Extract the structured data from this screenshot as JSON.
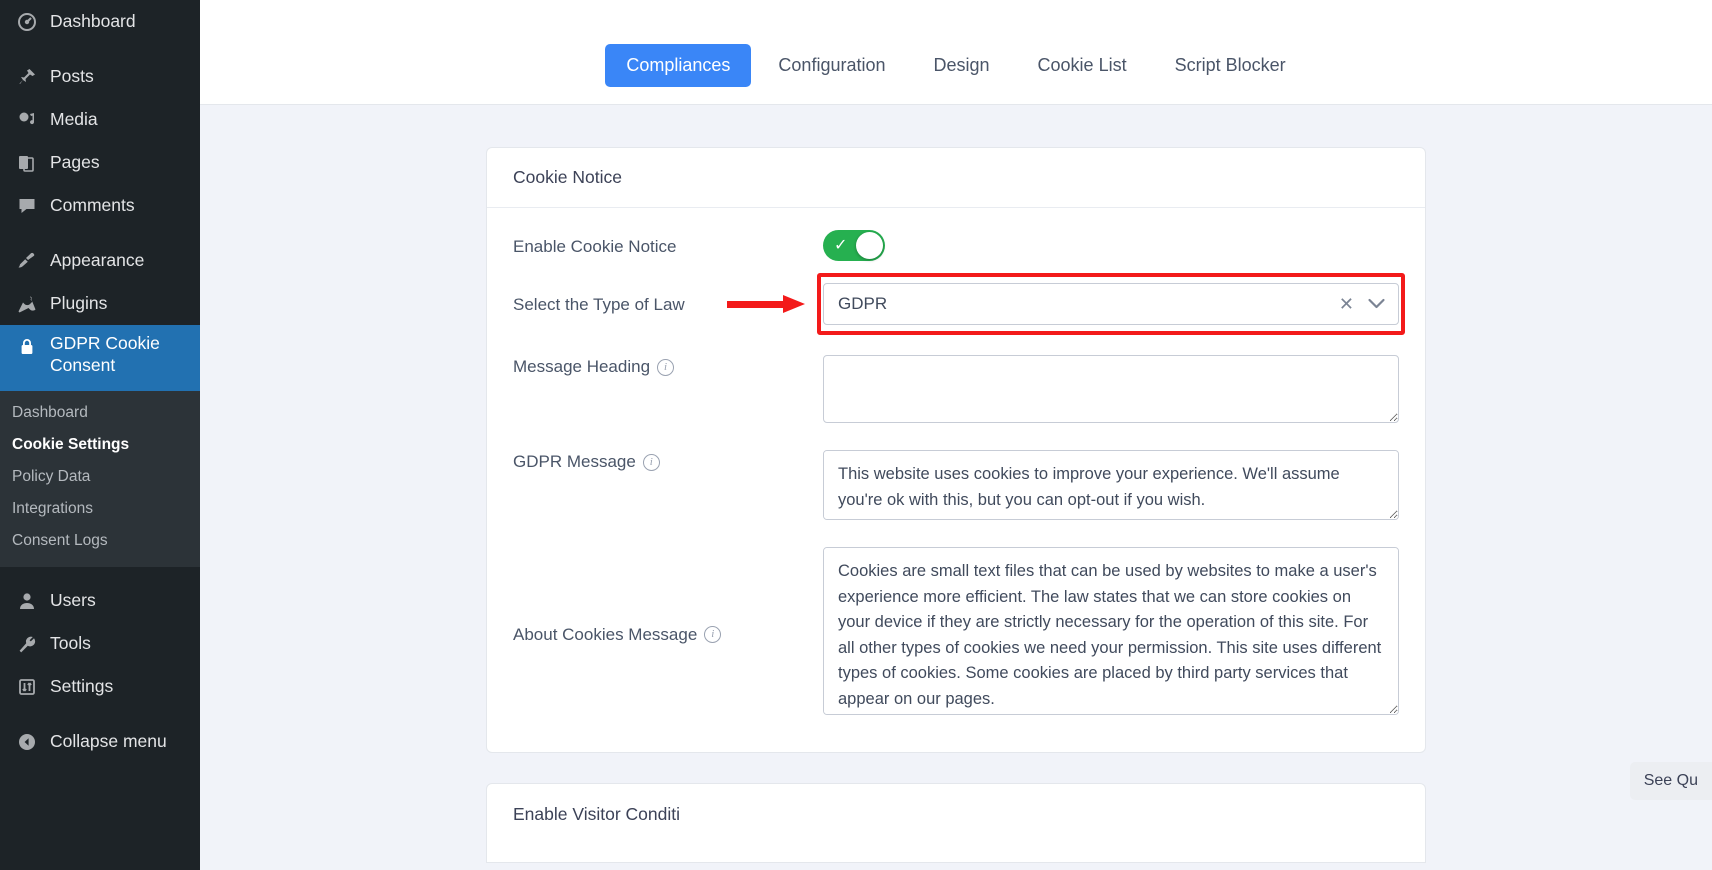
{
  "sidebar": {
    "items": [
      {
        "label": "Dashboard",
        "icon": "dashboard-icon",
        "name": "dashboard"
      },
      {
        "label": "Posts",
        "icon": "pin-icon",
        "name": "posts"
      },
      {
        "label": "Media",
        "icon": "media-icon",
        "name": "media"
      },
      {
        "label": "Pages",
        "icon": "pages-icon",
        "name": "pages"
      },
      {
        "label": "Comments",
        "icon": "comment-icon",
        "name": "comments"
      },
      {
        "label": "Appearance",
        "icon": "brush-icon",
        "name": "appearance"
      },
      {
        "label": "Plugins",
        "icon": "plug-icon",
        "name": "plugins"
      }
    ],
    "current": {
      "label": "GDPR Cookie Consent",
      "icon": "lock-icon",
      "name": "gdpr-cookie-consent"
    },
    "submenu": [
      {
        "label": "Dashboard",
        "active": false
      },
      {
        "label": "Cookie Settings",
        "active": true
      },
      {
        "label": "Policy Data",
        "active": false
      },
      {
        "label": "Integrations",
        "active": false
      },
      {
        "label": "Consent Logs",
        "active": false
      }
    ],
    "items_after": [
      {
        "label": "Users",
        "icon": "user-icon",
        "name": "users"
      },
      {
        "label": "Tools",
        "icon": "wrench-icon",
        "name": "tools"
      },
      {
        "label": "Settings",
        "icon": "sliders-icon",
        "name": "settings"
      }
    ],
    "collapse": {
      "label": "Collapse menu",
      "icon": "chevron-left-circle-icon"
    }
  },
  "tabs": [
    {
      "label": "Compliances",
      "active": true
    },
    {
      "label": "Configuration",
      "active": false
    },
    {
      "label": "Design",
      "active": false
    },
    {
      "label": "Cookie List",
      "active": false
    },
    {
      "label": "Script Blocker",
      "active": false
    }
  ],
  "card": {
    "title": "Cookie Notice",
    "enable_label": "Enable Cookie Notice",
    "enable_value": true,
    "toggle_check_glyph": "✓",
    "law_label": "Select the Type of Law",
    "law_value": "GDPR",
    "law_clear_glyph": "✕",
    "law_chevron_glyph": "⌄",
    "heading_label": "Message Heading",
    "heading_value": "",
    "heading_placeholder": "",
    "gdpr_message_label": "GDPR Message",
    "gdpr_message_value": "This website uses cookies to improve your experience. We'll assume you're ok with this, but you can opt-out if you wish.",
    "about_label": "About Cookies Message",
    "about_value": "Cookies are small text files that can be used by websites to make a user's experience more efficient. The law states that we can store cookies on your device if they are strictly necessary for the operation of this site. For all other types of cookies we need your permission. This site uses different types of cookies. Some cookies are placed by third party services that appear on our pages."
  },
  "card_partial": {
    "title": "Enable Visitor Conditi"
  },
  "see_qu": {
    "label": "See Qu"
  },
  "colors": {
    "accent_blue": "#3a86f7",
    "wp_blue": "#2271b1",
    "toggle_green": "#26b050",
    "highlight_red": "#f31a1a",
    "sidebar_bg": "#1d2327",
    "page_bg": "#f1f3f9"
  }
}
